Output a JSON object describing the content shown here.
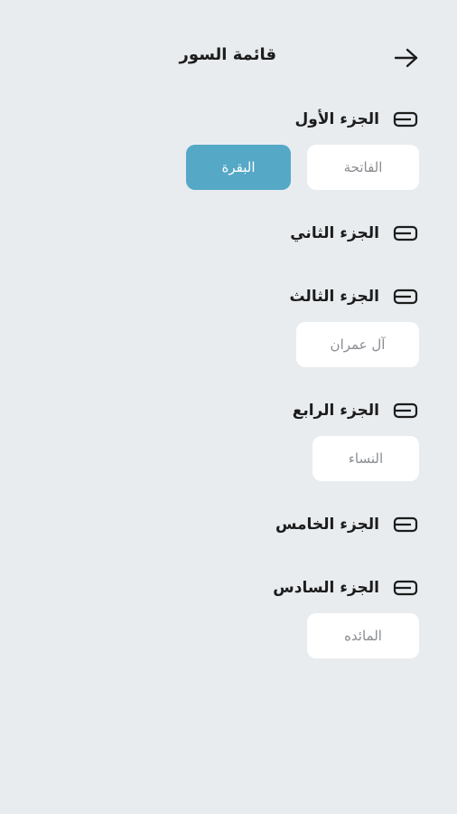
{
  "header": {
    "title": "قائمة السور",
    "back_icon": "arrow-right-icon"
  },
  "juz": [
    {
      "label": "الجزء الأول",
      "icon": "juz-book-icon",
      "surahs": [
        {
          "name": "الفاتحة",
          "active": false
        },
        {
          "name": "البقرة",
          "active": true
        }
      ]
    },
    {
      "label": "الجزء الثاني",
      "icon": "juz-book-icon",
      "surahs": []
    },
    {
      "label": "الجزء الثالث",
      "icon": "juz-book-icon",
      "surahs": [
        {
          "name": "آل عمران",
          "active": false
        }
      ]
    },
    {
      "label": "الجزء الرابع",
      "icon": "juz-book-icon",
      "surahs": [
        {
          "name": "النساء",
          "active": false
        }
      ]
    },
    {
      "label": "الجزء الخامس",
      "icon": "juz-book-icon",
      "surahs": []
    },
    {
      "label": "الجزء السادس",
      "icon": "juz-book-icon",
      "surahs": [
        {
          "name": "المائده",
          "active": false
        }
      ]
    }
  ],
  "colors": {
    "background": "#e8ecef",
    "accent": "#55a8c6",
    "chip": "#ffffff",
    "text": "#1c1c1c",
    "muted_text": "#8a8d91"
  }
}
